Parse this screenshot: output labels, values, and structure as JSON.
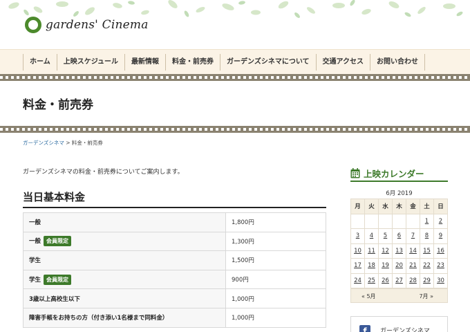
{
  "header": {
    "logo_text": "gardens' Cinema"
  },
  "nav": {
    "items": [
      "ホーム",
      "上映スケジュール",
      "最新情報",
      "料金・前売券",
      "ガーデンズシネマについて",
      "交通アクセス",
      "お問い合わせ"
    ]
  },
  "page": {
    "title": "料金・前売券",
    "breadcrumb_home": "ガーデンズシネマ",
    "breadcrumb_sep": " > ",
    "breadcrumb_current": "料金・前売券",
    "intro": "ガーデンズシネマの料金・前売券についてご案内します。"
  },
  "fees": {
    "section_title": "当日基本料金",
    "badge_label": "会員限定",
    "rows": [
      {
        "label": "一般",
        "price": "1,800円"
      },
      {
        "label": "一般",
        "badge": true,
        "price": "1,300円"
      },
      {
        "label": "学生",
        "price": "1,500円"
      },
      {
        "label": "学生",
        "badge": true,
        "price": "900円"
      },
      {
        "label": "3歳以上高校生以下",
        "price": "1,000円"
      },
      {
        "label": "障害手帳をお持ちの方（付き添い1名様まで同料金）",
        "price": "1,000円"
      }
    ]
  },
  "calendar": {
    "title": "上映カレンダー",
    "caption": "6月 2019",
    "weekdays": [
      "月",
      "火",
      "水",
      "木",
      "金",
      "土",
      "日"
    ],
    "weeks": [
      [
        "",
        "",
        "",
        "",
        "",
        "1",
        "2"
      ],
      [
        "3",
        "4",
        "5",
        "6",
        "7",
        "8",
        "9"
      ],
      [
        "10",
        "11",
        "12",
        "13",
        "14",
        "15",
        "16"
      ],
      [
        "17",
        "18",
        "19",
        "20",
        "21",
        "22",
        "23"
      ],
      [
        "24",
        "25",
        "26",
        "27",
        "28",
        "29",
        "30"
      ]
    ],
    "prev_label": "« 5月",
    "next_label": "7月 »"
  },
  "facebook": {
    "label": "ガーデンズシネマ"
  },
  "colors": {
    "accent_green": "#3d7a2a",
    "nav_bg": "#fbf3e6",
    "film_strip": "#8a8270",
    "link_blue": "#2d6ca2"
  }
}
